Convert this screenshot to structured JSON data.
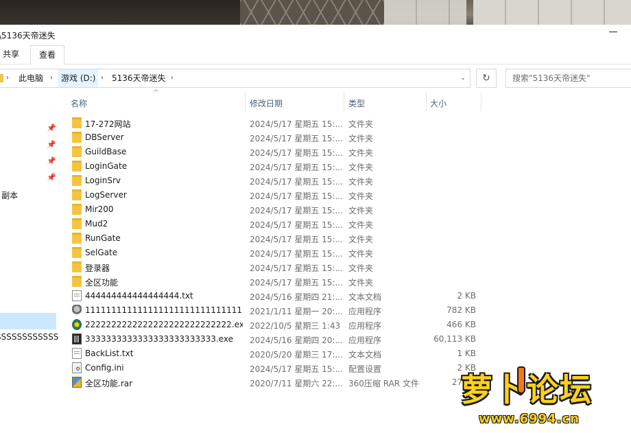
{
  "window": {
    "title": "\\5136天帝迷失"
  },
  "ribbon": {
    "tabs": [
      "共享",
      "查看"
    ]
  },
  "address": {
    "crumbs": [
      "此电脑",
      "游戏 (D:)",
      "5136天帝迷失"
    ],
    "refresh_icon": "refresh-icon",
    "search_placeholder": "搜索\"5136天帝迷失\""
  },
  "nav": {
    "items": [
      "- 副本",
      ")",
      "SSSSSSSSSSSS"
    ]
  },
  "columns": {
    "name": "名称",
    "date": "修改日期",
    "type": "类型",
    "size": "大小"
  },
  "files": [
    {
      "name": "17-272网站",
      "date": "2024/5/17 星期五 15:...",
      "type": "文件夹",
      "size": "",
      "icon": "folder"
    },
    {
      "name": "DBServer",
      "date": "2024/5/17 星期五 15:...",
      "type": "文件夹",
      "size": "",
      "icon": "folder"
    },
    {
      "name": "GuildBase",
      "date": "2024/5/17 星期五 15:...",
      "type": "文件夹",
      "size": "",
      "icon": "folder"
    },
    {
      "name": "LoginGate",
      "date": "2024/5/17 星期五 15:...",
      "type": "文件夹",
      "size": "",
      "icon": "folder"
    },
    {
      "name": "LoginSrv",
      "date": "2024/5/17 星期五 15:...",
      "type": "文件夹",
      "size": "",
      "icon": "folder"
    },
    {
      "name": "LogServer",
      "date": "2024/5/17 星期五 15:...",
      "type": "文件夹",
      "size": "",
      "icon": "folder"
    },
    {
      "name": "Mir200",
      "date": "2024/5/17 星期五 15:...",
      "type": "文件夹",
      "size": "",
      "icon": "folder"
    },
    {
      "name": "Mud2",
      "date": "2024/5/17 星期五 15:...",
      "type": "文件夹",
      "size": "",
      "icon": "folder"
    },
    {
      "name": "RunGate",
      "date": "2024/5/17 星期五 15:...",
      "type": "文件夹",
      "size": "",
      "icon": "folder"
    },
    {
      "name": "SelGate",
      "date": "2024/5/17 星期五 15:...",
      "type": "文件夹",
      "size": "",
      "icon": "folder"
    },
    {
      "name": "登录器",
      "date": "2024/5/17 星期五 15:...",
      "type": "文件夹",
      "size": "",
      "icon": "folder"
    },
    {
      "name": "全区功能",
      "date": "2024/5/17 星期五 15:...",
      "type": "文件夹",
      "size": "",
      "icon": "folder"
    },
    {
      "name": "444444444444444444.txt",
      "date": "2024/5/16 星期四 21:...",
      "type": "文本文档",
      "size": "2 KB",
      "icon": "doc"
    },
    {
      "name": "1111111111111111111111111111111...",
      "date": "2021/1/11 星期一 20:...",
      "type": "应用程序",
      "size": "782 KB",
      "icon": "exe1"
    },
    {
      "name": "2222222222222222222222222222.exe",
      "date": "2022/10/5 星期三 1:43",
      "type": "应用程序",
      "size": "466 KB",
      "icon": "exe2"
    },
    {
      "name": "3333333333333333333333333.exe",
      "date": "2024/5/16 星期四 20:...",
      "type": "应用程序",
      "size": "60,113 KB",
      "icon": "exe3"
    },
    {
      "name": "BackList.txt",
      "date": "2020/5/20 星期三 17:...",
      "type": "文本文档",
      "size": "1 KB",
      "icon": "doc"
    },
    {
      "name": "Config.ini",
      "date": "2024/5/17 星期五 15:...",
      "type": "配置设置",
      "size": "2 KB",
      "icon": "ini"
    },
    {
      "name": "全区功能.rar",
      "date": "2020/7/11 星期六 22:...",
      "type": "360压缩 RAR 文件",
      "size": "27 KB",
      "icon": "rar"
    }
  ],
  "watermark": {
    "text": "萝卜论坛",
    "url": "www.6994.cn"
  }
}
